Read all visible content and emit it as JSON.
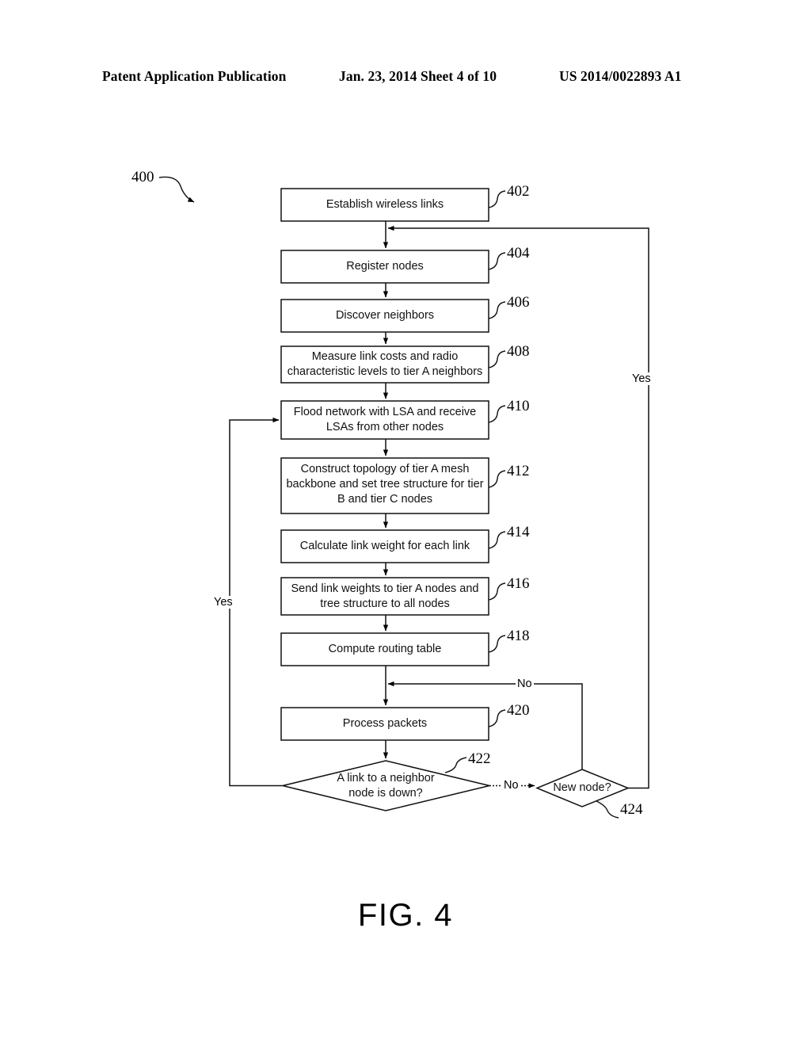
{
  "header": {
    "left": "Patent Application Publication",
    "middle": "Jan. 23, 2014  Sheet 4 of 10",
    "right": "US 2014/0022893 A1"
  },
  "figure": {
    "caption": "FIG. 4",
    "diagram_ref": "400"
  },
  "flowchart": {
    "type": "flowchart",
    "nodes": [
      {
        "ref": "402",
        "shape": "process",
        "text": "Establish wireless links"
      },
      {
        "ref": "404",
        "shape": "process",
        "text": "Register nodes"
      },
      {
        "ref": "406",
        "shape": "process",
        "text": "Discover neighbors"
      },
      {
        "ref": "408",
        "shape": "process",
        "text": "Measure link costs and radio\ncharacteristic levels to tier A neighbors"
      },
      {
        "ref": "410",
        "shape": "process",
        "text": "Flood network with LSA and receive\nLSAs from other nodes"
      },
      {
        "ref": "412",
        "shape": "process",
        "text": "Construct topology of tier A mesh\nbackbone and set tree structure for tier\nB and tier C nodes"
      },
      {
        "ref": "414",
        "shape": "process",
        "text": "Calculate link weight for each link"
      },
      {
        "ref": "416",
        "shape": "process",
        "text": "Send link weights to tier A nodes and\ntree structure to all nodes"
      },
      {
        "ref": "418",
        "shape": "process",
        "text": "Compute routing table"
      },
      {
        "ref": "420",
        "shape": "process",
        "text": "Process packets"
      },
      {
        "ref": "422",
        "shape": "decision",
        "text": "A link to a neighbor\nnode is down?"
      },
      {
        "ref": "424",
        "shape": "decision",
        "text": "New node?"
      }
    ],
    "edge_labels": {
      "link_down_yes": "Yes",
      "link_down_no": "No",
      "new_node_yes": "Yes",
      "new_node_no": "No"
    }
  }
}
